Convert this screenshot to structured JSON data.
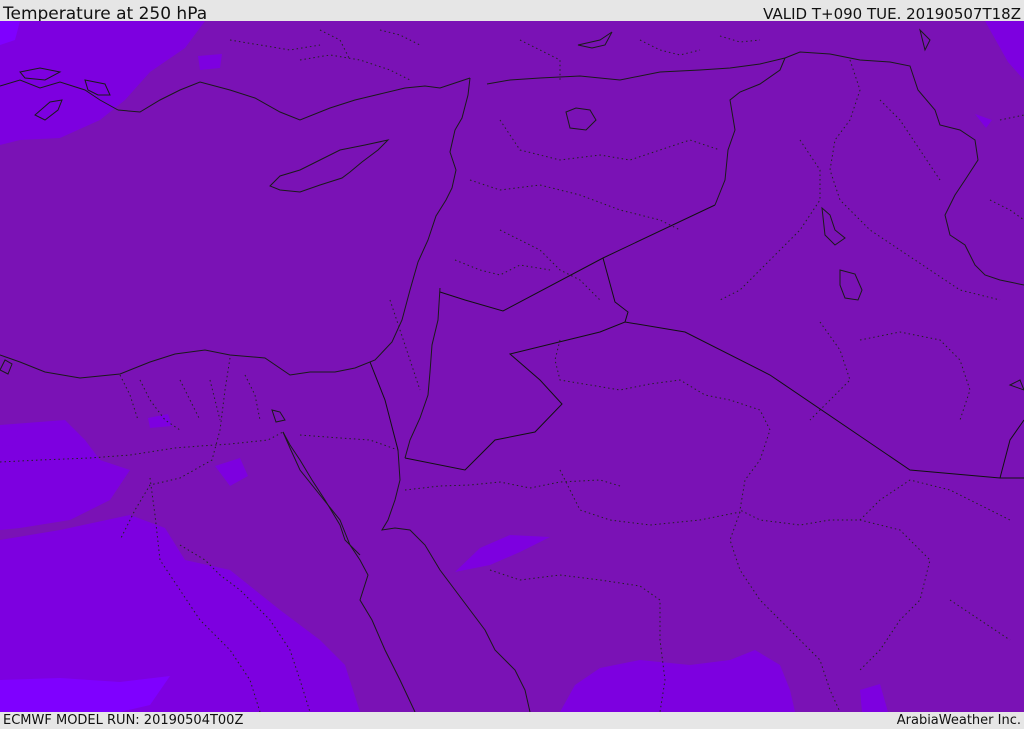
{
  "header": {
    "title": "Temperature at 250 hPa",
    "valid": "VALID T+090 TUE. 20190507T18Z"
  },
  "footer": {
    "model_run": "ECMWF MODEL RUN: 20190504T00Z",
    "credit": "ArabiaWeather Inc."
  },
  "map": {
    "fill_colors": {
      "main": "#7a12b5",
      "cooler": "#7d00e0",
      "coldest": "#7f00ff"
    }
  }
}
